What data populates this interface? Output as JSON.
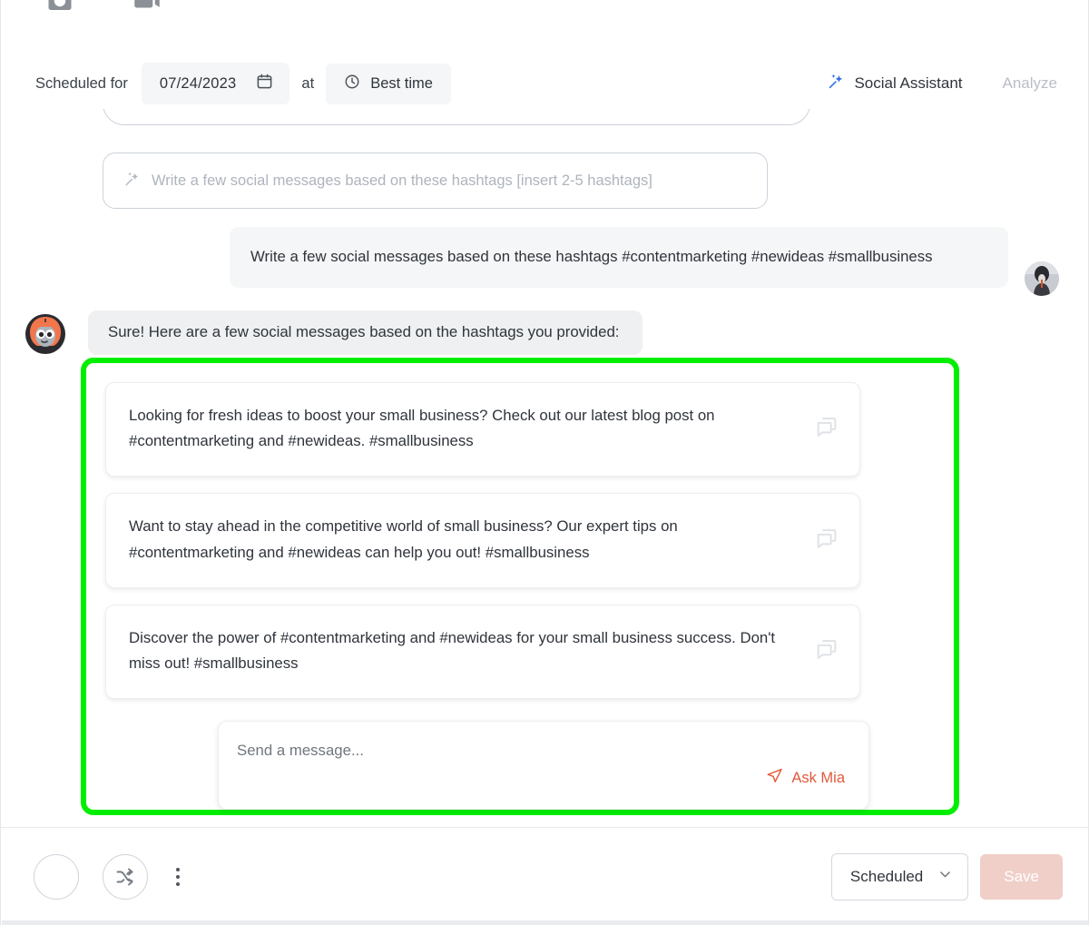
{
  "toolbar_top": {
    "icons": [
      {
        "name": "image-icon",
        "label": "Image"
      },
      {
        "name": "video-icon",
        "label": "Video"
      }
    ]
  },
  "schedule": {
    "label": "Scheduled for",
    "date_value": "07/24/2023",
    "calendar_icon": "calendar-icon",
    "at_label": "at",
    "time_value": "Best time",
    "clock_icon": "clock-icon"
  },
  "tabs": {
    "assistant_label": "Social Assistant",
    "assistant_icon": "magic-wand-icon",
    "analyze_label": "Analyze",
    "active": "Social Assistant"
  },
  "prompt_suggestion": {
    "text": "Write a few social messages based on these hashtags [insert 2-5 hashtags]",
    "icon": "magic-wand-icon"
  },
  "conversation": {
    "user_message": "Write a few social messages based on these hashtags #contentmarketing #newideas #smallbusiness",
    "bot_message": "Sure! Here are a few social messages based on the hashtags you provided:"
  },
  "suggestions": {
    "highlight_color": "#00ee00",
    "cards": [
      {
        "text": "Looking for fresh ideas to boost your small business? Check out our latest blog post on #contentmarketing and #newideas. #smallbusiness",
        "action_icon": "copy-to-post-icon"
      },
      {
        "text": "Want to stay ahead in the competitive world of small business? Our expert tips on #contentmarketing and #newideas can help you out! #smallbusiness",
        "action_icon": "copy-to-post-icon"
      },
      {
        "text": "Discover the power of #contentmarketing and #newideas for your small business success. Don't miss out! #smallbusiness",
        "action_icon": "copy-to-post-icon"
      }
    ]
  },
  "composer": {
    "placeholder": "Send a message...",
    "send_label": "Ask Mia",
    "send_icon": "paper-plane-icon",
    "send_color": "#e2583b"
  },
  "footer": {
    "avatar_placeholder_name": "profile-circle",
    "shuffle_icon": "shuffle-icon",
    "more_icon": "kebab-menu-icon",
    "status_value": "Scheduled",
    "status_caret_icon": "chevron-down-icon",
    "save_label": "Save"
  }
}
